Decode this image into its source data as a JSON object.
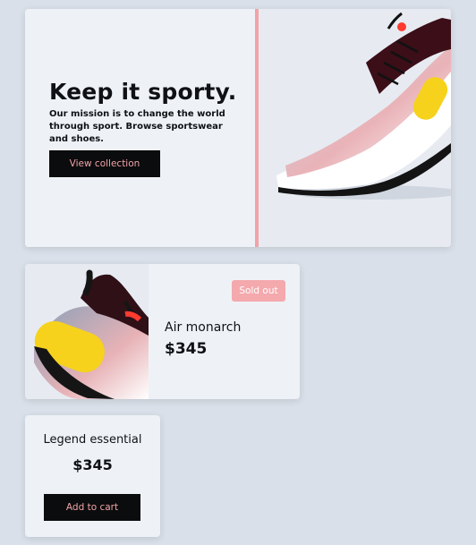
{
  "hero": {
    "title": "Keep it sporty.",
    "description": "Our mission is to change the world through sport. Browse sportswear and shoes.",
    "cta_label": "View collection"
  },
  "product": {
    "name": "Air monarch",
    "price": "$345",
    "badge": "Sold out"
  },
  "small_card": {
    "name": "Legend essential",
    "price": "$345",
    "cta_label": "Add to cart"
  },
  "colors": {
    "background": "#d9e0e9",
    "card": "#eef2f6",
    "accent_pink": "#f2a3a8",
    "button_dark": "#0b0c0d",
    "shoe_yellow": "#f6d21c"
  },
  "images": {
    "hero": "sneaker-photo",
    "product": "sneaker-photo"
  }
}
